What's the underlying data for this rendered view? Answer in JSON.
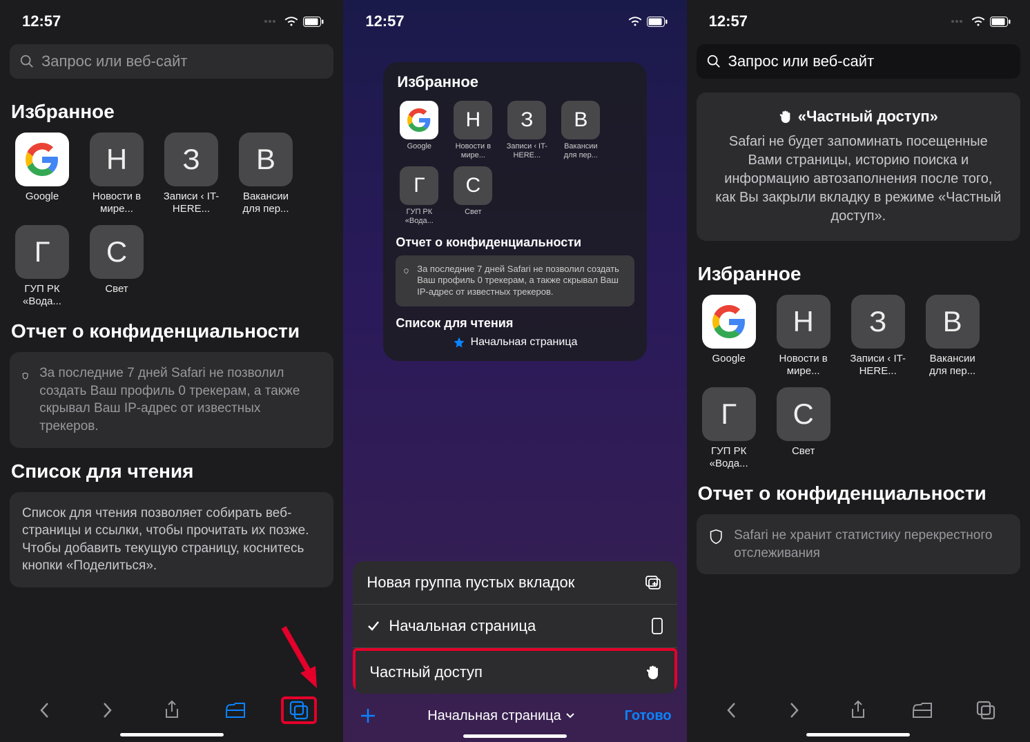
{
  "time": "12:57",
  "search_placeholder": "Запрос или веб-сайт",
  "favorites_title": "Избранное",
  "favorites": [
    {
      "letter": "G",
      "google": true,
      "label": "Google"
    },
    {
      "letter": "Н",
      "label": "Новости в мире..."
    },
    {
      "letter": "З",
      "label": "Записи ‹ IT-HERE..."
    },
    {
      "letter": "В",
      "label": "Вакансии для пер..."
    },
    {
      "letter": "Г",
      "label": "ГУП РК «Вода..."
    },
    {
      "letter": "С",
      "label": "Свет"
    }
  ],
  "privacy_title": "Отчет о конфиденциальности",
  "privacy_text": "За последние 7 дней Safari не позволил создать Ваш профиль 0 трекерам, а также скрывал Ваш IP-адрес от известных трекеров.",
  "reading_title": "Список для чтения",
  "reading_text": "Список для чтения позволяет собирать веб-страницы и ссылки, чтобы прочитать их позже. Чтобы добавить текущую страницу, коснитесь кнопки «Поделиться».",
  "mid": {
    "reading_start": "Начальная страница",
    "sheet_new_group": "Новая группа пустых вкладок",
    "sheet_start": "Начальная страница",
    "sheet_private": "Частный доступ",
    "bottom_label": "Начальная страница",
    "done": "Готово"
  },
  "right": {
    "private_title": "«Частный доступ»",
    "private_body": "Safari не будет запоминать посещенные Вами страницы, историю поиска и информацию автозаполнения после того, как Вы закрыли вкладку в режиме «Частный доступ».",
    "privacy_text3": "Safari не хранит статистику перекрестного отслеживания"
  }
}
